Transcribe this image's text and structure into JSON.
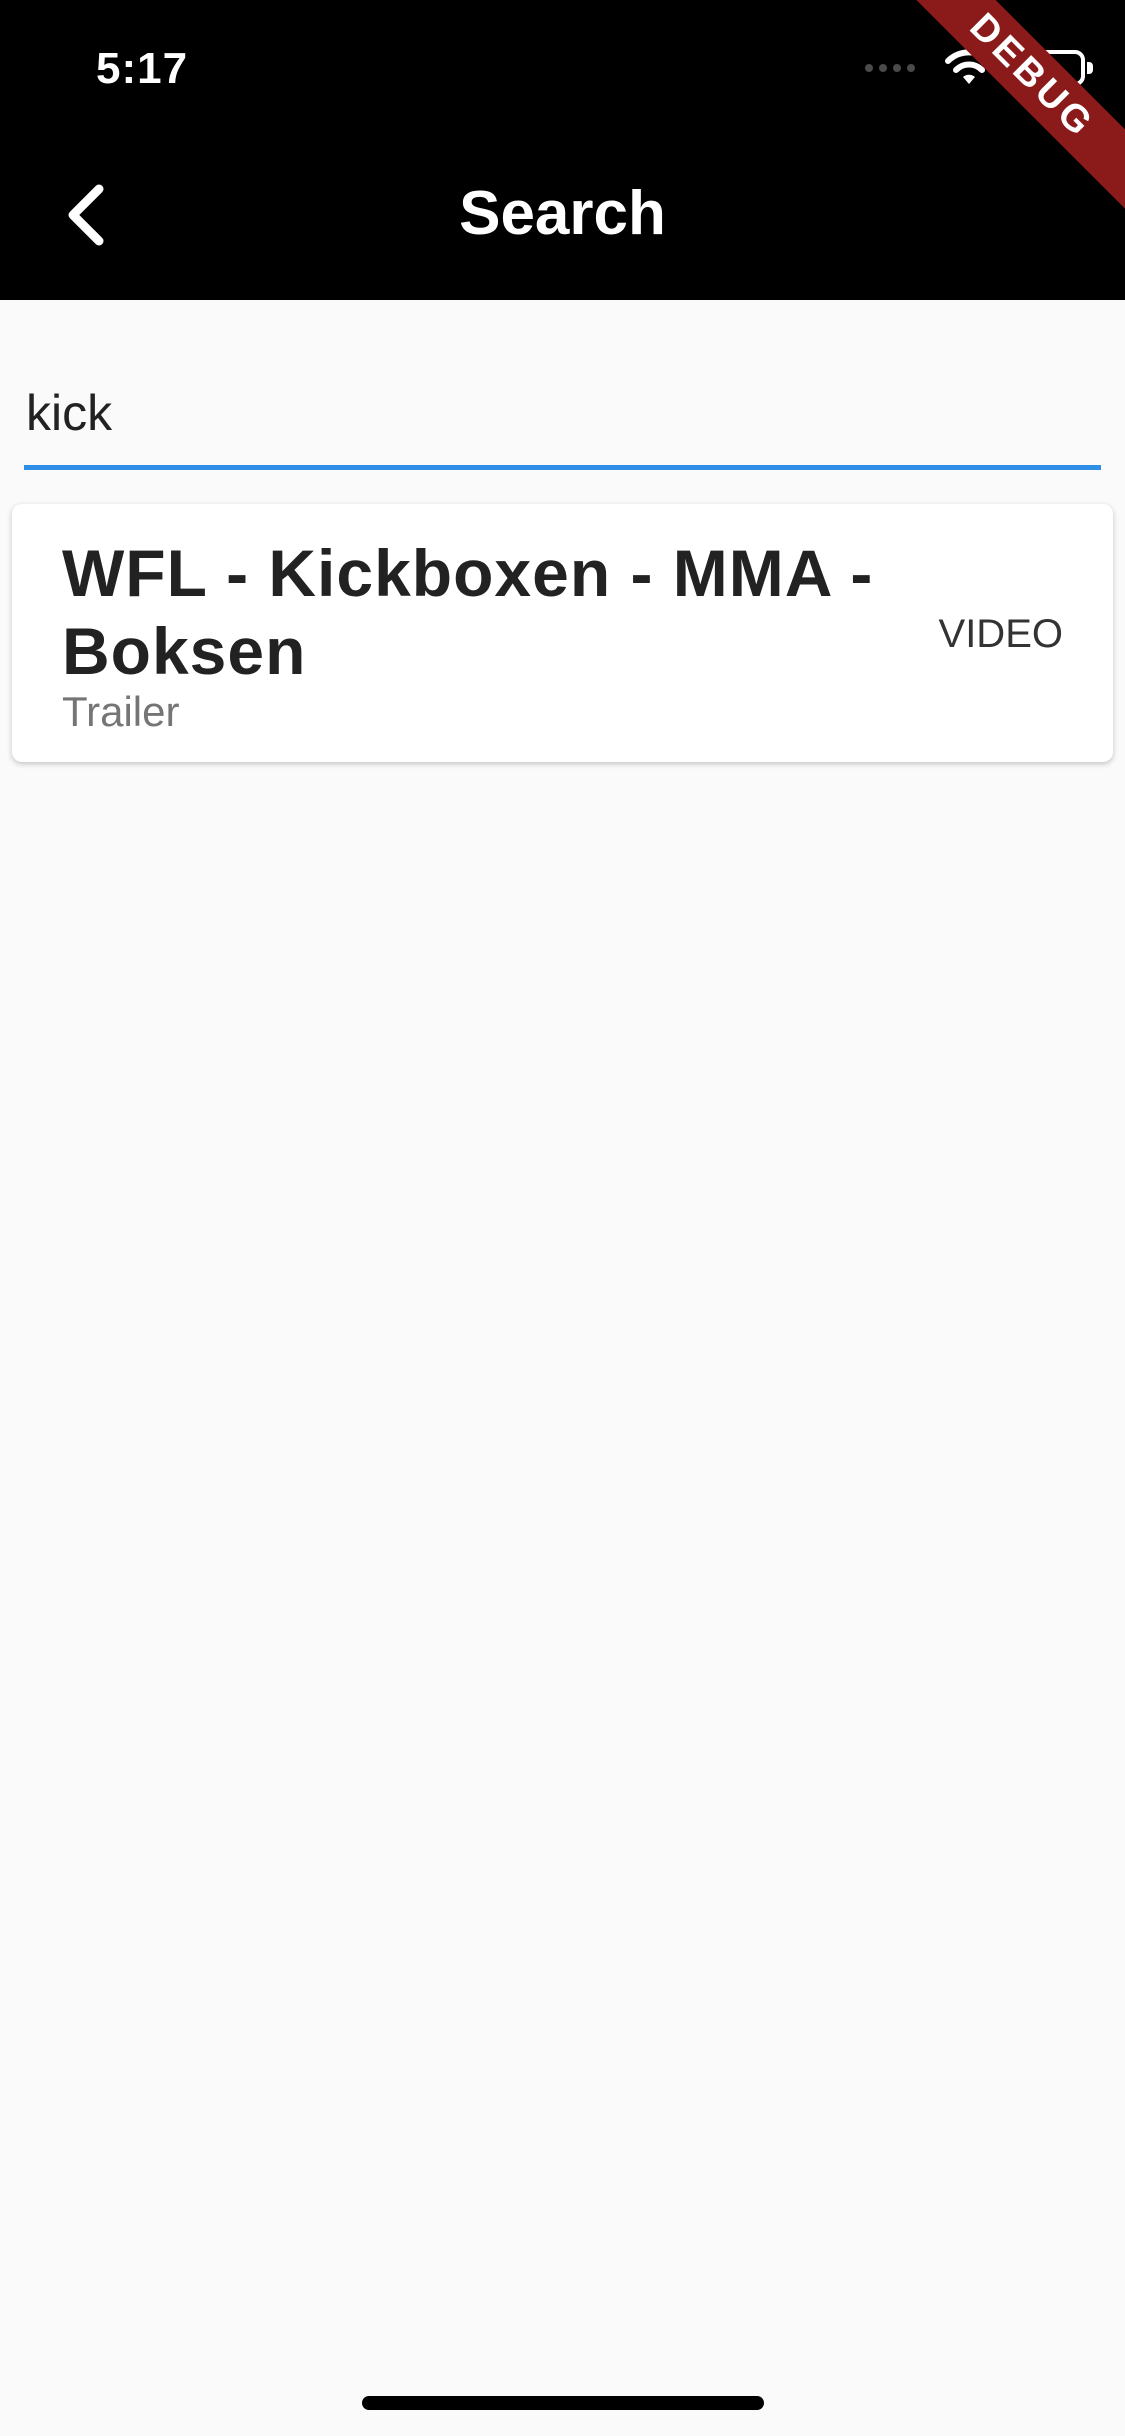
{
  "status_bar": {
    "time": "5:17",
    "signal_icon": "signal-dots-icon",
    "wifi_icon": "wifi-icon",
    "battery_icon": "battery-icon"
  },
  "debug_banner": {
    "label": "DEBUG",
    "color": "#8b1a1a"
  },
  "header": {
    "title": "Search",
    "back_icon": "chevron-left-icon",
    "background": "#000000"
  },
  "search": {
    "value": "kick",
    "accent": "#2f8fe6"
  },
  "results": [
    {
      "title": "WFL - Kickboxen - MMA - Boksen",
      "subtitle": "Trailer",
      "type": "VIDEO"
    }
  ]
}
